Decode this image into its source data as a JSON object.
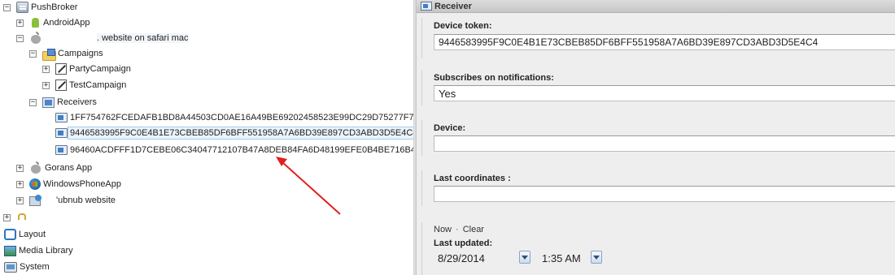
{
  "tree": {
    "root": {
      "label": "PushBroker",
      "icon": "server-icon",
      "toggle": "−"
    },
    "apps": [
      {
        "label": "AndroidApp",
        "icon": "android-icon",
        "toggle": "+"
      },
      {
        "label": ". website on safari mac",
        "icon": "apple-icon",
        "toggle": "−"
      },
      {
        "label": "Gorans App",
        "icon": "apple-icon",
        "toggle": "+"
      },
      {
        "label": "WindowsPhoneApp",
        "icon": "windows-icon",
        "toggle": "+"
      },
      {
        "label": "'ubnub website",
        "icon": "web-icon",
        "toggle": "+"
      }
    ],
    "campaigns": {
      "label": "Campaigns",
      "toggle": "−",
      "items": [
        {
          "label": "PartyCampaign",
          "toggle": "+"
        },
        {
          "label": "TestCampaign",
          "toggle": "+"
        }
      ]
    },
    "receivers": {
      "label": "Receivers",
      "toggle": "−",
      "items": [
        {
          "label": "1FF754762FCEDAFB1BD8A44503CD0AE16A49BE69202458523E99DC29D75277F7"
        },
        {
          "label": "9446583995F9C0E4B1E73CBEB85DF6BFF551958A7A6BD39E897CD3ABD3D5E4C4",
          "selected": true
        },
        {
          "label": "96460ACDFFF1D7CEBE06C34047712107B47A8DEB84FA6D48199EFE0B4BE716B4"
        }
      ]
    },
    "extra_toggle": "+"
  },
  "modules": [
    {
      "label": "Layout",
      "icon": "layout-icon"
    },
    {
      "label": "Media Library",
      "icon": "media-icon"
    },
    {
      "label": "System",
      "icon": "system-icon"
    }
  ],
  "panel": {
    "title": "Receiver",
    "device_token": {
      "label": "Device token:",
      "value": "9446583995F9C0E4B1E73CBEB85DF6BFF551958A7A6BD39E897CD3ABD3D5E4C4"
    },
    "subscribes": {
      "label": "Subscribes on notifications:",
      "value": "Yes"
    },
    "device": {
      "label": "Device:",
      "value": ""
    },
    "coords": {
      "label": "Last coordinates :",
      "value": ""
    },
    "date_links": {
      "now": "Now",
      "dot": "·",
      "clear": "Clear"
    },
    "last_updated": {
      "label": "Last updated:",
      "date": "8/29/2014",
      "time": "1:35 AM"
    }
  },
  "colors": {
    "arrow": "#e02020",
    "selection_bg": "#eaf3fb",
    "panel_bg": "#eeeeee"
  }
}
